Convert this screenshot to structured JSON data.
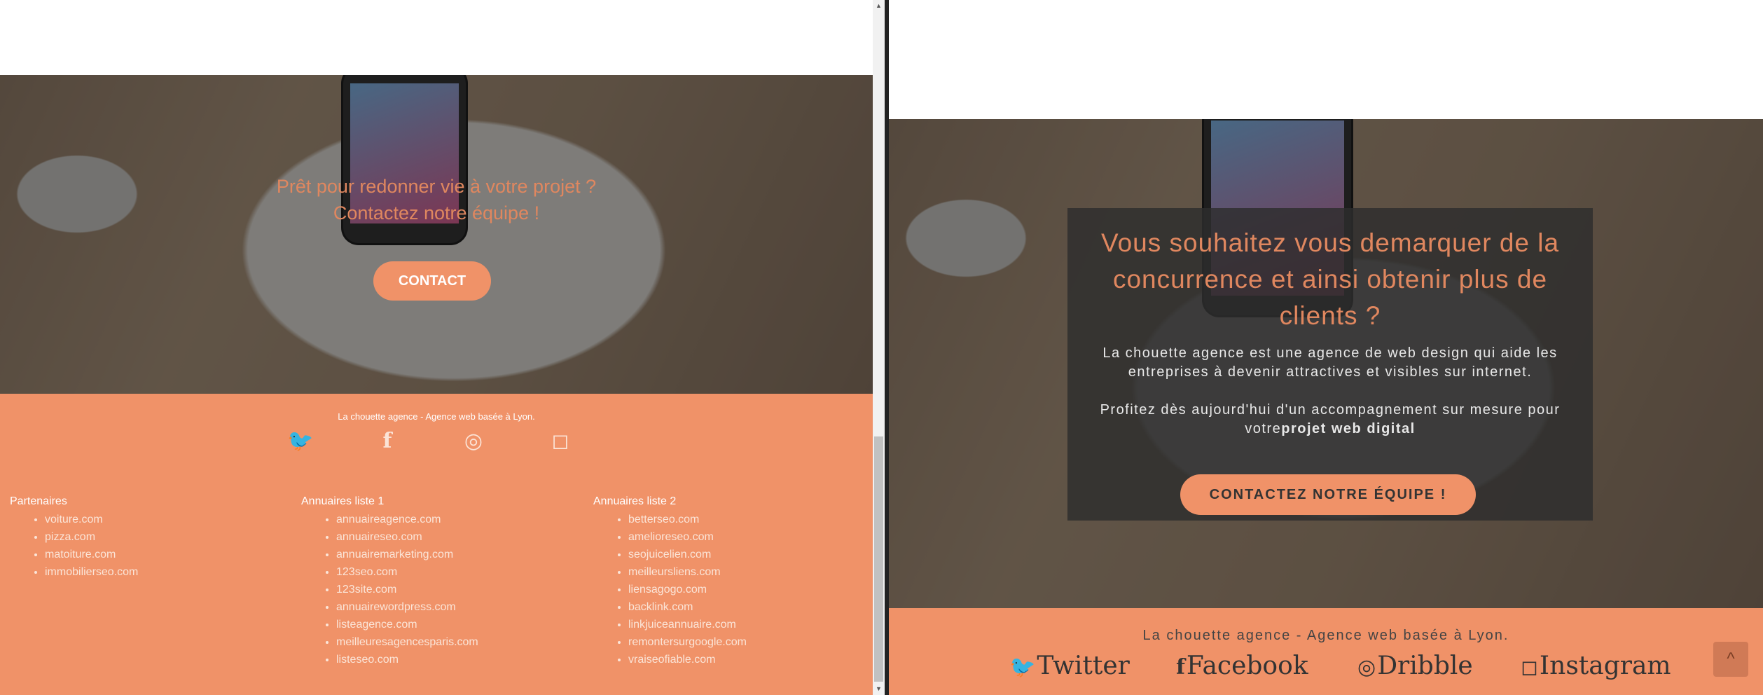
{
  "left": {
    "hero": {
      "line1": "Prêt pour redonner vie à votre projet ?",
      "line2": "Contactez notre équipe !",
      "button": "CONTACT"
    },
    "footer": {
      "tagline": "La chouette agence - Agence web basée à Lyon.",
      "icons": [
        "twitter-icon",
        "facebook-icon",
        "dribbble-icon",
        "instagram-icon"
      ],
      "columns": [
        {
          "title": "Partenaires",
          "items": [
            "voiture.com",
            "pizza.com",
            "matoiture.com",
            "immobilierseo.com"
          ]
        },
        {
          "title": "Annuaires liste 1",
          "items": [
            "annuaireagence.com",
            "annuaireseo.com",
            "annuairemarketing.com",
            "123seo.com",
            "123site.com",
            "annuairewordpress.com",
            "listeagence.com",
            "meilleuresagencesparis.com",
            "listeseo.com"
          ]
        },
        {
          "title": "Annuaires liste 2",
          "items": [
            "betterseo.com",
            "amelioreseo.com",
            "seojuicelien.com",
            "meilleursliens.com",
            "liensagogo.com",
            "backlink.com",
            "linkjuiceannuaire.com",
            "remontersurgoogle.com",
            "vraiseofiable.com"
          ]
        }
      ]
    }
  },
  "right": {
    "hero": {
      "heading": "Vous souhaitez vous demarquer de la concurrence et ainsi obtenir plus de clients ?",
      "para1": "La chouette agence est une agence de web design qui aide les entreprises à devenir attractives et visibles sur internet.",
      "para2_prefix": "Profitez dès aujourd'hui d'un accompagnement sur mesure pour votre",
      "para2_bold": "projet web digital",
      "button": "CONTACTEZ NOTRE ÉQUIPE !"
    },
    "footer": {
      "tagline": "La chouette agence - Agence web basée à Lyon.",
      "links": [
        {
          "icon": "twitter-icon",
          "glyph": "🐦",
          "label": "Twitter"
        },
        {
          "icon": "facebook-icon",
          "glyph": "f",
          "label": "Facebook"
        },
        {
          "icon": "dribbble-icon",
          "glyph": "◎",
          "label": "Dribble"
        },
        {
          "icon": "instagram-icon",
          "glyph": "◻",
          "label": "Instagram"
        }
      ],
      "back_to_top": "^"
    }
  },
  "colors": {
    "accent": "#f09268",
    "heading_orange": "#e0875f",
    "overlay_card": "#2d2d2d"
  }
}
